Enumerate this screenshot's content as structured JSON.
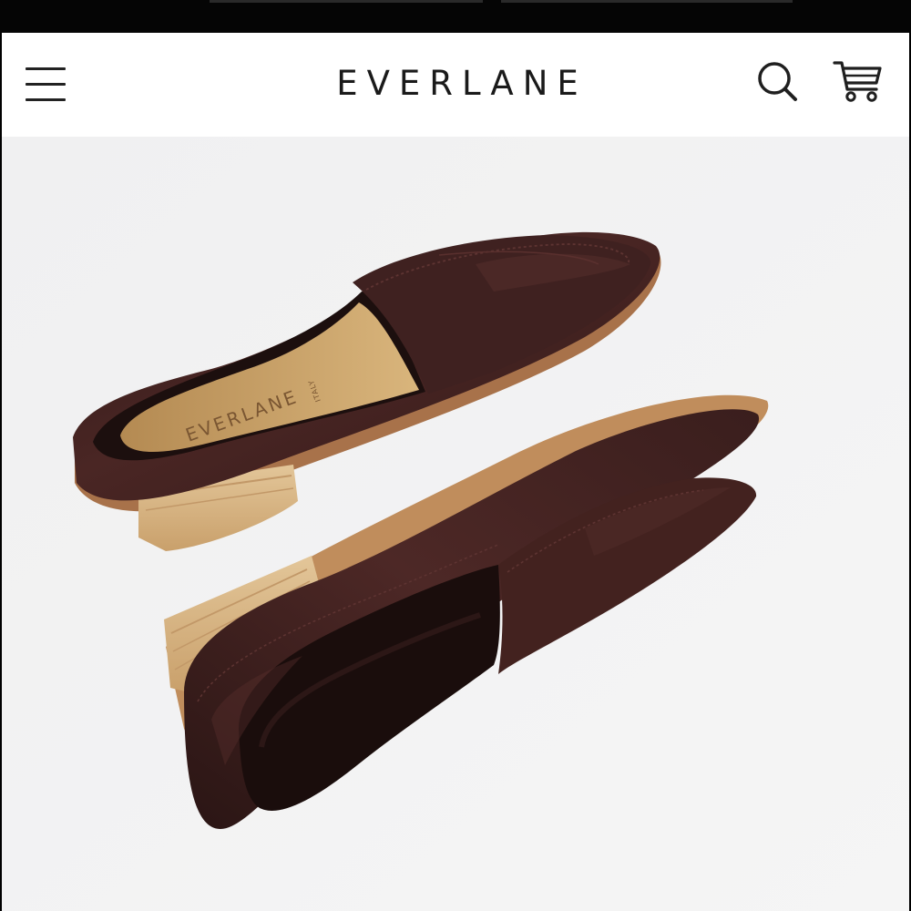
{
  "header": {
    "brand": "EVERLANE",
    "icons": {
      "menu": "hamburger-menu-icon",
      "search": "search-icon",
      "cart": "shopping-cart-icon"
    }
  },
  "hero": {
    "image_subject": "Pair of dark brown leather loafers with stacked wooden heels",
    "insole_brand": "EVERLANE",
    "insole_origin": "ITALY"
  },
  "colors": {
    "header_bg": "#ffffff",
    "hero_bg": "#f1f1f1",
    "text": "#1a1a1a",
    "leather": "#3d1f1d",
    "heel_wood": "#d9b98c",
    "insole": "#caa36a"
  }
}
